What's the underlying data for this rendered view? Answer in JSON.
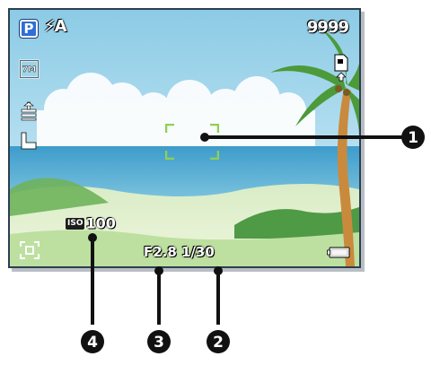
{
  "osd": {
    "mode": "P",
    "flash": "⚡A",
    "shots_remaining": "9999",
    "resolution": "7M",
    "iso_label": "ISO",
    "iso_value": "100",
    "aperture": "F2.8",
    "shutter_speed": "1/30"
  },
  "callouts": [
    {
      "number": "1"
    },
    {
      "number": "2"
    },
    {
      "number": "3"
    },
    {
      "number": "4"
    }
  ],
  "icons": [
    "mode-p-icon",
    "flash-auto-icon",
    "resolution-icon",
    "white-balance-icon",
    "metering-icon",
    "memory-card-icon",
    "af-area-icon",
    "battery-icon",
    "focus-frame-icon"
  ],
  "colors": {
    "frame": "#2c3e50",
    "focus": "#8fd14f",
    "mode_badge": "#2f6fd6",
    "callout": "#111111"
  }
}
